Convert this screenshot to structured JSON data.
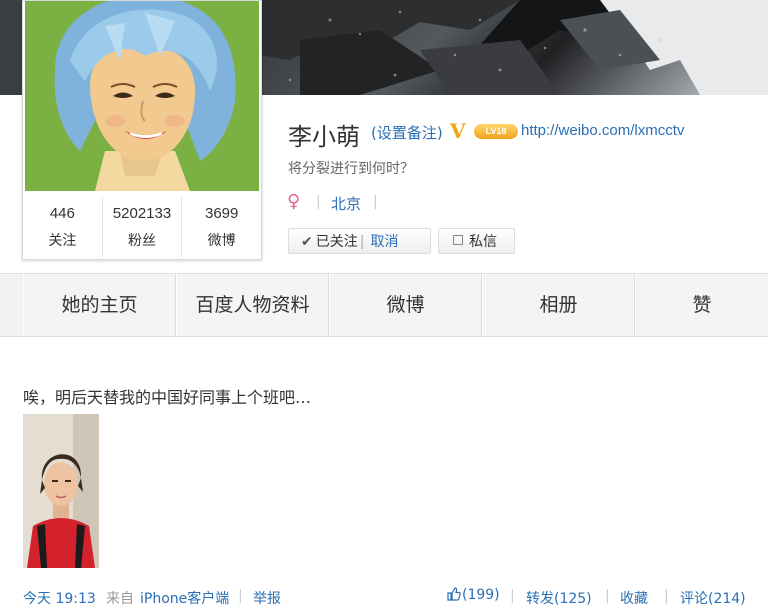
{
  "profile": {
    "name": "李小萌",
    "remark_label": "(设置备注)",
    "verified_mark": "V",
    "level_badge": "LV18",
    "url": "http://weibo.com/lxmcctv",
    "bio": "将分裂进行到何时？",
    "gender_icon": "female-icon",
    "location": "北京",
    "followed_label": "已关注",
    "cancel_label": "取消",
    "message_label": "私信"
  },
  "stats": [
    {
      "num": "446",
      "label": "关注"
    },
    {
      "num": "5202133",
      "label": "粉丝"
    },
    {
      "num": "3699",
      "label": "微博"
    }
  ],
  "tabs": [
    "她的主页",
    "百度人物资料",
    "微博",
    "相册",
    "赞"
  ],
  "post": {
    "text": "唉，明后天替我的中国好同事上个班吧…",
    "time": "今天 19:13",
    "source_prefix": "来自",
    "source_link": "iPhone客户端",
    "report_label": "举报",
    "like_label": "(199)",
    "repost_label": "转发(125)",
    "favorite_label": "收藏",
    "comment_label": "评论(214)"
  },
  "colors": {
    "link": "#2a6fb6",
    "avatar_bg": "#7bb042",
    "female_pink": "#e5649b",
    "verified_orange": "#f2a60d"
  }
}
